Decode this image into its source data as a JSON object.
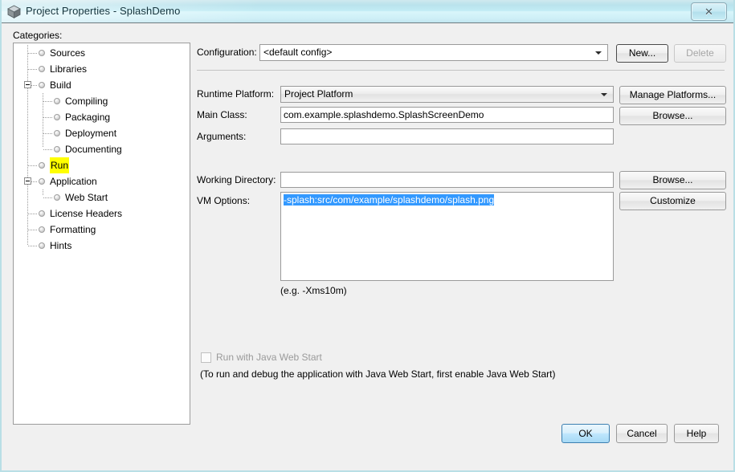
{
  "window": {
    "title": "Project Properties - SplashDemo",
    "icon": "cube-icon",
    "close_label": "✕",
    "border_color": "#b9dfe6",
    "titlebar_accent": "#c2ecf5"
  },
  "categories": {
    "label": "Categories:",
    "highlight_color": "#ffff00",
    "items": [
      {
        "label": "Sources",
        "depth": 0,
        "expander": null,
        "selected": false
      },
      {
        "label": "Libraries",
        "depth": 0,
        "expander": null,
        "selected": false
      },
      {
        "label": "Build",
        "depth": 0,
        "expander": "collapse",
        "selected": false
      },
      {
        "label": "Compiling",
        "depth": 1,
        "expander": null,
        "selected": false
      },
      {
        "label": "Packaging",
        "depth": 1,
        "expander": null,
        "selected": false
      },
      {
        "label": "Deployment",
        "depth": 1,
        "expander": null,
        "selected": false
      },
      {
        "label": "Documenting",
        "depth": 1,
        "expander": null,
        "selected": false
      },
      {
        "label": "Run",
        "depth": 0,
        "expander": null,
        "selected": true
      },
      {
        "label": "Application",
        "depth": 0,
        "expander": "collapse",
        "selected": false
      },
      {
        "label": "Web Start",
        "depth": 1,
        "expander": null,
        "selected": false
      },
      {
        "label": "License Headers",
        "depth": 0,
        "expander": null,
        "selected": false
      },
      {
        "label": "Formatting",
        "depth": 0,
        "expander": null,
        "selected": false
      },
      {
        "label": "Hints",
        "depth": 0,
        "expander": null,
        "selected": false
      }
    ]
  },
  "form": {
    "configuration": {
      "label": "Configuration:",
      "value": "<default config>",
      "new_label": "New...",
      "delete_label": "Delete",
      "delete_disabled": true
    },
    "runtime_platform": {
      "label": "Runtime Platform:",
      "value": "Project Platform",
      "button_label": "Manage Platforms..."
    },
    "main_class": {
      "label": "Main Class:",
      "value": "com.example.splashdemo.SplashScreenDemo",
      "button_label": "Browse..."
    },
    "arguments": {
      "label": "Arguments:",
      "value": ""
    },
    "working_directory": {
      "label": "Working Directory:",
      "value": "",
      "button_label": "Browse..."
    },
    "vm_options": {
      "label": "VM Options:",
      "value": "-splash:src/com/example/splashdemo/splash.png",
      "selected": true,
      "selection_color": "#3399ff",
      "hint": "(e.g. -Xms10m)",
      "button_label": "Customize"
    },
    "web_start": {
      "checkbox_label": "Run with Java Web Start",
      "checked": false,
      "disabled": true,
      "note": "(To run and debug the application with Java Web Start, first enable Java Web Start)"
    }
  },
  "bottom_buttons": {
    "ok": "OK",
    "cancel": "Cancel",
    "help": "Help",
    "focused": "ok"
  }
}
